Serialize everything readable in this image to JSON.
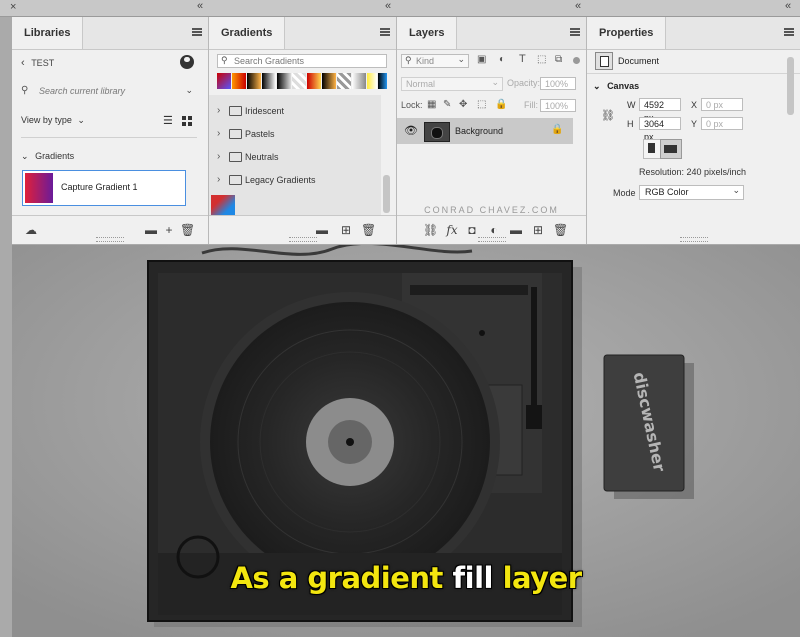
{
  "window": {
    "close_glyph": "×",
    "collapse_glyph": "«"
  },
  "libraries": {
    "tab": "Libraries",
    "library_name": "TEST",
    "search_placeholder": "Search current library",
    "view_label": "View by type",
    "section": "Gradients",
    "item": "Capture Gradient 1"
  },
  "gradients": {
    "tab": "Gradients",
    "search_placeholder": "Search Gradients",
    "folders": [
      "Iridescent",
      "Pastels",
      "Neutrals",
      "Legacy Gradients"
    ]
  },
  "layers": {
    "tab": "Layers",
    "kind_label": "Kind",
    "blend_mode": "Normal",
    "opacity_label": "Opacity:",
    "opacity_value": "100%",
    "lock_label": "Lock:",
    "fill_label": "Fill:",
    "fill_value": "100%",
    "layer_name": "Background",
    "watermark": "CONRAD CHAVEZ.COM"
  },
  "properties": {
    "tab": "Properties",
    "doc_label": "Document",
    "section": "Canvas",
    "w_label": "W",
    "w_value": "4592 px",
    "h_label": "H",
    "h_value": "3064 px",
    "x_label": "X",
    "x_value": "0 px",
    "y_label": "Y",
    "y_value": "0 px",
    "resolution": "Resolution: 240 pixels/inch",
    "mode_label": "Mode",
    "mode_value": "RGB Color"
  },
  "canvas": {
    "caption_part1": "As a gradient ",
    "caption_part2": "fill",
    "caption_part3": " layer",
    "caption_color_yellow": "#f3e60f",
    "caption_color_white": "#ffffff",
    "box_brand": "discwasher"
  },
  "colors": {
    "panel_bg": "#f0f0f0",
    "selected_layer": "#c9c9c9",
    "accent_blue": "#3a86d8"
  }
}
